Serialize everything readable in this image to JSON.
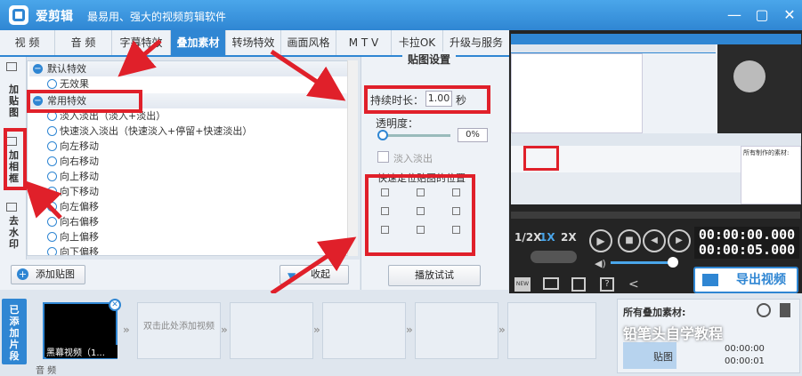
{
  "app": {
    "name": "爱剪辑",
    "slogan": "最易用、强大的视频剪辑软件"
  },
  "window": {
    "minimize": "—",
    "maximize": "▢",
    "close": "✕"
  },
  "tabs": [
    "视 频",
    "音 频",
    "字幕特效",
    "叠加素材",
    "转场特效",
    "画面风格",
    "M T V",
    "卡拉OK",
    "升级与服务"
  ],
  "rail": {
    "sticker": "加贴图",
    "frame": "加相框",
    "watermark": "去水印"
  },
  "tree": {
    "group1": "默认特效",
    "group1_items": [
      "无效果"
    ],
    "group2": "常用特效",
    "group2_items": [
      "淡入淡出（淡入+淡出）",
      "快速淡入淡出（快速淡入+停留+快速淡出）",
      "向左移动",
      "向右移动",
      "向上移动",
      "向下移动",
      "向左偏移",
      "向右偏移",
      "向上偏移",
      "向下偏移"
    ]
  },
  "buttons": {
    "add_sticker": "添加贴图",
    "collapse": "收起",
    "play_test": "播放试试"
  },
  "settings": {
    "title": "贴图设置",
    "duration_label": "持续时长：",
    "duration_value": "1.00",
    "duration_unit": "秒",
    "opacity_label": "透明度：",
    "opacity_value": "0%",
    "fade_label": "淡入淡出",
    "position_label": "快速定位贴图的位置"
  },
  "player": {
    "time_current": "00:00:00.000",
    "time_total": "00:00:05.000",
    "speeds": [
      "1/2X",
      "1X",
      "2X"
    ],
    "export": "导出视频",
    "export_small": "导出视频"
  },
  "clips": {
    "added_label": "已添加片段",
    "first_clip": "黑幕视频（1...",
    "add_hint": "双击此处添加视频",
    "audio": "音 频"
  },
  "overlay": {
    "title": "所有叠加素材:",
    "item": "贴图",
    "time": "00:00:00",
    "time2": "00:00:01"
  },
  "watermark": "铅笔头自学教程",
  "thumb": {
    "tabs": [
      "视频",
      "音频",
      "字幕特效",
      "叠加素材",
      "转场特效",
      "画面风格",
      "MTV",
      "卡拉OK",
      "升级与服务"
    ],
    "panel": "贴图设置",
    "all": "所有制作的素材:"
  }
}
